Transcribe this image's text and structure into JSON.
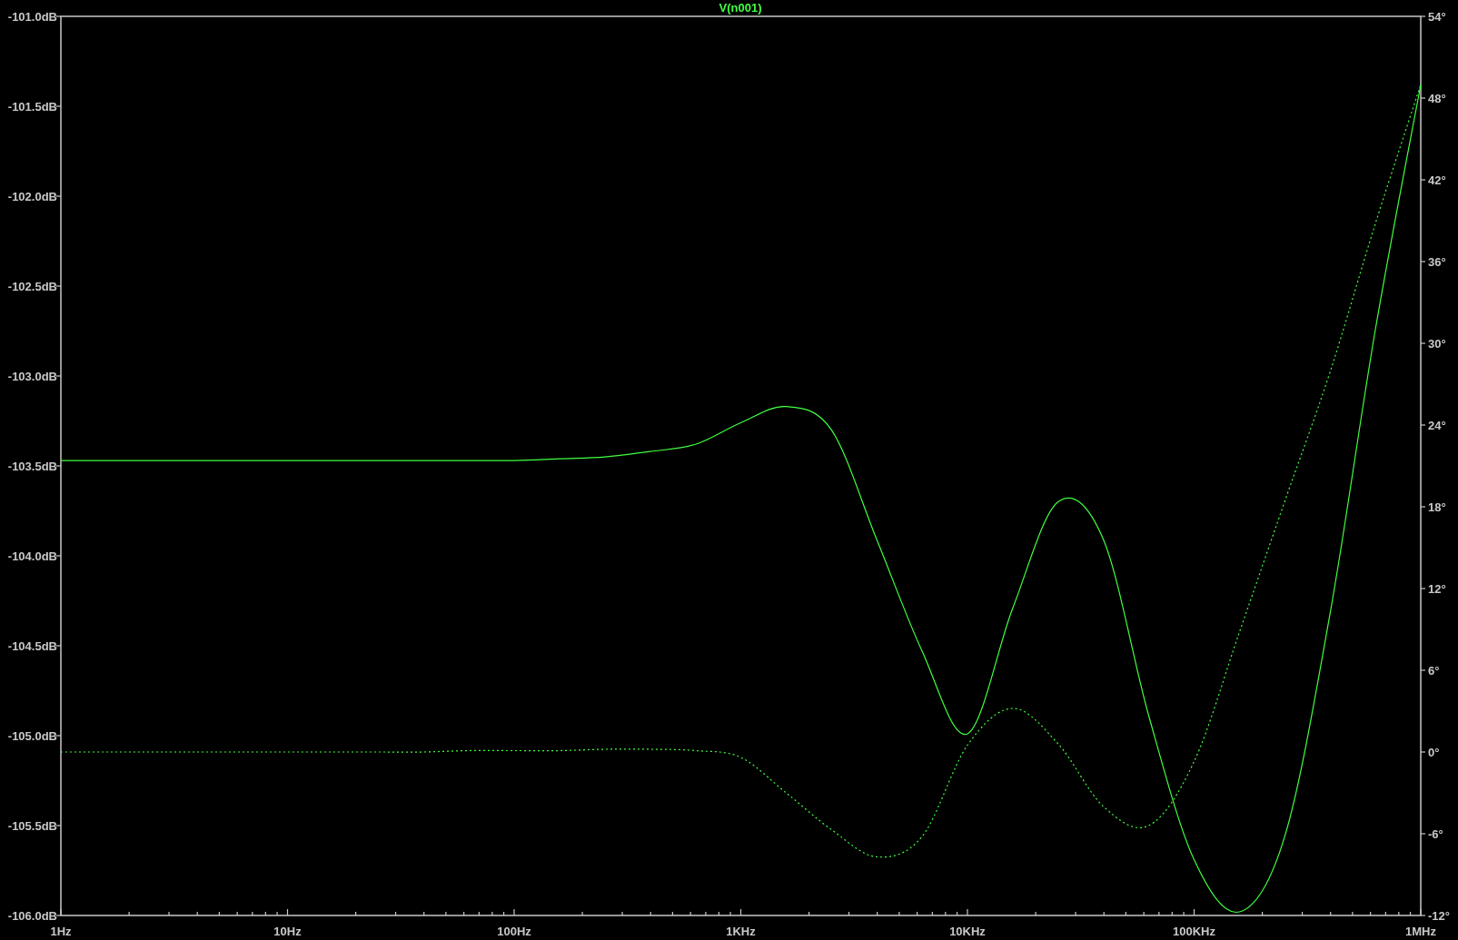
{
  "plot": {
    "magnitude": {
      "chart_data": {
        "type": "line",
        "title": "V(n001)",
        "categories": [
          "1Hz",
          null,
          null,
          null,
          null,
          "10Hz",
          null,
          null,
          null,
          null,
          "100Hz",
          null,
          null,
          null,
          null,
          "1KHz",
          null,
          null,
          null,
          null,
          "10KHz",
          null,
          null,
          null,
          null,
          "100KHz",
          null,
          null,
          null,
          null,
          "1MHz"
        ],
        "series": [
          {
            "color": "#40ff40",
            "line_style": "solid",
            "values": [
              -103.47,
              -103.47,
              -103.47,
              -103.47,
              -103.47,
              -103.47,
              -103.47,
              -103.47,
              -103.47,
              -103.47,
              -103.47,
              -103.46,
              -103.45,
              -103.42,
              -103.38,
              -103.26,
              -103.17,
              -103.3,
              -103.91,
              -104.53,
              -104.99,
              -104.29,
              -103.7,
              -103.91,
              -104.89,
              -105.69,
              -105.98,
              -105.56,
              -104.32,
              -102.74,
              -101.38
            ]
          }
        ],
        "ylim": [
          -106,
          -101
        ],
        "yticks": [
          {
            "value": -101,
            "label": "-101.0dB"
          },
          {
            "value": -101.5,
            "label": "-101.5dB"
          },
          {
            "value": -102,
            "label": "-102.0dB"
          },
          {
            "value": -102.5,
            "label": "-102.5dB"
          },
          {
            "value": -103,
            "label": "-103.0dB"
          },
          {
            "value": -103.5,
            "label": "-103.5dB"
          },
          {
            "value": -104,
            "label": "-104.0dB"
          },
          {
            "value": -104.5,
            "label": "-104.5dB"
          },
          {
            "value": -105,
            "label": "-105.0dB"
          },
          {
            "value": -105.5,
            "label": "-105.5dB"
          },
          {
            "value": -106,
            "label": "-106.0dB"
          }
        ]
      }
    },
    "phase": {
      "chart_data": {
        "type": "line",
        "categories": [
          null,
          null,
          null,
          null,
          null,
          null,
          null,
          null,
          null,
          null,
          null,
          null,
          null,
          null,
          null,
          null,
          null,
          null,
          null,
          null,
          null,
          null,
          null,
          null,
          null,
          null,
          null,
          null,
          null,
          null,
          null
        ],
        "series": [
          {
            "color": "#40ff40",
            "line_style": "dashed",
            "values": [
              0,
              0,
              0,
              0,
              0,
              0,
              0,
              0,
              0,
              0.1,
              0.1,
              0.1,
              0.2,
              0.2,
              0.1,
              -0.4,
              -3.0,
              -5.7,
              -7.7,
              -6.2,
              0.5,
              3.2,
              0.6,
              -4.0,
              -5.4,
              -0.7,
              8.8,
              18.4,
              27.9,
              38.8,
              49.0
            ]
          }
        ],
        "ylim": [
          -12,
          54
        ],
        "yticks": [
          {
            "value": 54,
            "label": "54°"
          },
          {
            "value": 48,
            "label": "48°"
          },
          {
            "value": 42,
            "label": "42°"
          },
          {
            "value": 36,
            "label": "36°"
          },
          {
            "value": 30,
            "label": "30°"
          },
          {
            "value": 24,
            "label": "24°"
          },
          {
            "value": 18,
            "label": "18°"
          },
          {
            "value": 12,
            "label": "12°"
          },
          {
            "value": 6,
            "label": "6°"
          },
          {
            "value": 0,
            "label": "0°"
          },
          {
            "value": -6,
            "label": "-6°"
          },
          {
            "value": -12,
            "label": "-12°"
          }
        ]
      }
    }
  }
}
